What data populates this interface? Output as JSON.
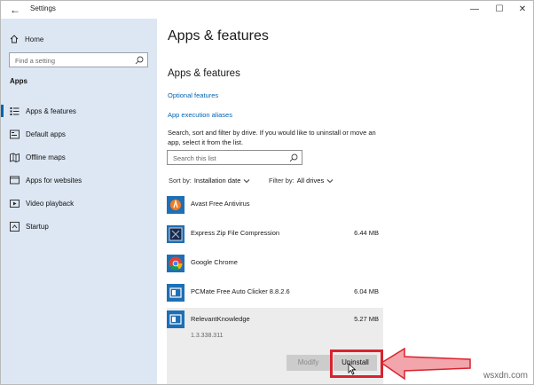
{
  "window": {
    "title": "Settings",
    "back_icon": "back-arrow-icon",
    "minimize": "—",
    "maximize": "☐",
    "close": "✕"
  },
  "sidebar": {
    "home_label": "Home",
    "search_placeholder": "Find a setting",
    "section_label": "Apps",
    "items": [
      {
        "label": "Apps & features",
        "icon": "apps-features-icon",
        "active": true
      },
      {
        "label": "Default apps",
        "icon": "default-apps-icon",
        "active": false
      },
      {
        "label": "Offline maps",
        "icon": "offline-maps-icon",
        "active": false
      },
      {
        "label": "Apps for websites",
        "icon": "apps-websites-icon",
        "active": false
      },
      {
        "label": "Video playback",
        "icon": "video-playback-icon",
        "active": false
      },
      {
        "label": "Startup",
        "icon": "startup-icon",
        "active": false
      }
    ]
  },
  "main": {
    "page_title": "Apps & features",
    "section_title": "Apps & features",
    "link_optional": "Optional features",
    "link_aliases": "App execution aliases",
    "description": "Search, sort and filter by drive. If you would like to uninstall or move an app, select it from the list.",
    "search_placeholder": "Search this list",
    "sort_label": "Sort by:",
    "sort_value": "Installation date",
    "filter_label": "Filter by:",
    "filter_value": "All drives",
    "apps": [
      {
        "name": "Avast Free Antivirus",
        "size": "",
        "icon": "avast-icon"
      },
      {
        "name": "Express Zip File Compression",
        "size": "6.44 MB",
        "icon": "express-zip-icon"
      },
      {
        "name": "Google Chrome",
        "size": "",
        "icon": "chrome-icon"
      },
      {
        "name": "PCMate Free Auto Clicker 8.8.2.6",
        "size": "6.04 MB",
        "icon": "pcmate-icon"
      }
    ],
    "selected_app": {
      "name": "RelevantKnowledge",
      "size": "5.27 MB",
      "version": "1.3.338.311",
      "modify_label": "Modify",
      "uninstall_label": "Uninstall"
    }
  },
  "colors": {
    "sidebar_bg": "#dde7f3",
    "accent": "#0063b1",
    "highlight": "#d9232e"
  },
  "watermark": "wsxdn.com"
}
